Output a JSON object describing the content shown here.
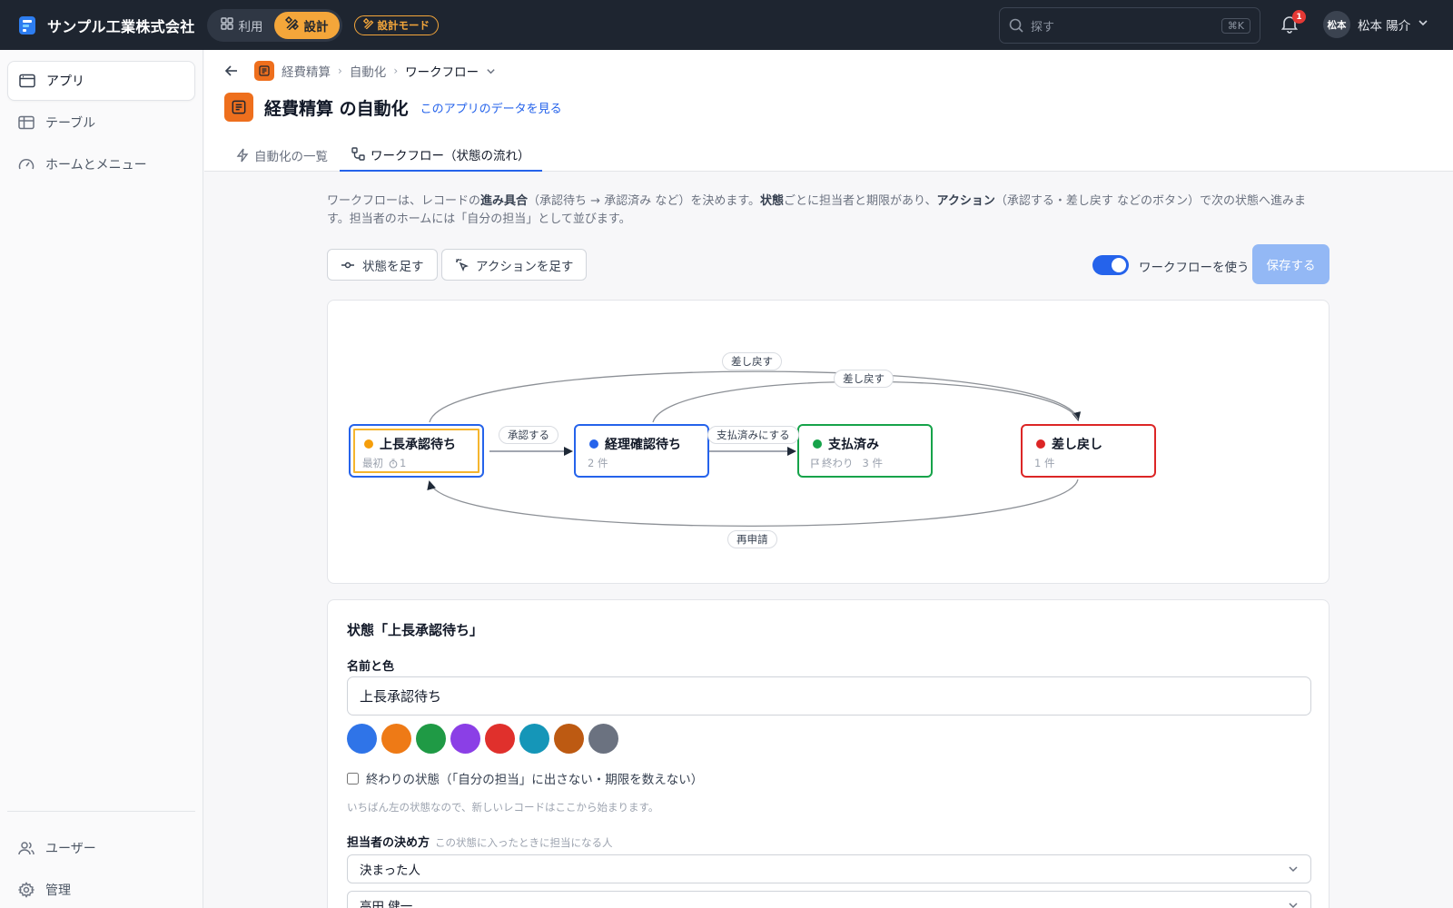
{
  "topbar": {
    "company": "サンプル工業株式会社",
    "mode_use": "利用",
    "mode_design": "設計",
    "design_mode_badge": "設計モード",
    "search_placeholder": "探す",
    "search_shortcut": "⌘K",
    "notification_count": "1",
    "user_avatar": "松本",
    "user_name": "松本 陽介"
  },
  "sidebar": {
    "items": [
      {
        "label": "アプリ",
        "icon": "app-window-icon",
        "active": true
      },
      {
        "label": "テーブル",
        "icon": "table-icon",
        "active": false
      },
      {
        "label": "ホームとメニュー",
        "icon": "gauge-icon",
        "active": false
      }
    ],
    "bottom_items": [
      {
        "label": "ユーザー",
        "icon": "users-icon"
      },
      {
        "label": "管理",
        "icon": "gear-icon"
      }
    ]
  },
  "breadcrumb": {
    "app": "経費精算",
    "section": "自動化",
    "current": "ワークフロー"
  },
  "page": {
    "title": "経費精算 の自動化",
    "view_data_link": "このアプリのデータを見る"
  },
  "tabs": [
    {
      "label": "自動化の一覧",
      "active": false
    },
    {
      "label": "ワークフロー（状態の流れ）",
      "active": true
    }
  ],
  "intro": {
    "t1": "ワークフローは、レコードの",
    "b1": "進み具合",
    "t2": "（承認待ち → 承認済み など）を決めます。",
    "b2": "状態",
    "t3": "ごとに担当者と期限があり、",
    "b3": "アクション",
    "t4": "（承認する・差し戻す などのボタン）で次の状態へ進みます。担当者のホームには「自分の担当」として並びます。"
  },
  "toolbar": {
    "add_state": "状態を足す",
    "add_action": "アクションを足す",
    "use_workflow": "ワークフローを使う",
    "use_workflow_on": true,
    "save": "保存する"
  },
  "workflow": {
    "states": [
      {
        "name": "上長承認待ち",
        "color": "#f59e0b",
        "border": "#2563eb",
        "meta1": "最初",
        "meta2": "1",
        "selected": true
      },
      {
        "name": "経理確認待ち",
        "color": "#2563eb",
        "border": "#2563eb",
        "meta1": "2 件"
      },
      {
        "name": "支払済み",
        "color": "#16a34a",
        "border": "#16a34a",
        "meta1": "終わり",
        "meta2": "3 件"
      },
      {
        "name": "差し戻し",
        "color": "#dc2626",
        "border": "#dc2626",
        "meta1": "1 件"
      }
    ],
    "actions": [
      {
        "label": "承認する",
        "from": "上長承認待ち",
        "to": "経理確認待ち"
      },
      {
        "label": "支払済みにする",
        "from": "経理確認待ち",
        "to": "支払済み"
      },
      {
        "label": "差し戻す",
        "from": "上長承認待ち",
        "to": "差し戻し"
      },
      {
        "label": "差し戻す",
        "from": "経理確認待ち",
        "to": "差し戻し"
      },
      {
        "label": "再申請",
        "from": "差し戻し",
        "to": "上長承認待ち"
      }
    ]
  },
  "detail": {
    "title": "状態「上長承認待ち」",
    "name_label": "名前と色",
    "name_value": "上長承認待ち",
    "swatches": [
      "#2f74e8",
      "#ee7a16",
      "#1f9a45",
      "#8b3fe6",
      "#e0302c",
      "#1596b8",
      "#bd5a12",
      "#6b7280"
    ],
    "final_state_label": "終わりの状態（「自分の担当」に出さない・期限を数えない）",
    "note": "いちばん左の状態なので、新しいレコードはここから始まります。",
    "assignee_label": "担当者の決め方",
    "assignee_hint": "この状態に入ったときに担当になる人",
    "assignee_mode": "決まった人",
    "assignee_person": "高田 健一"
  }
}
